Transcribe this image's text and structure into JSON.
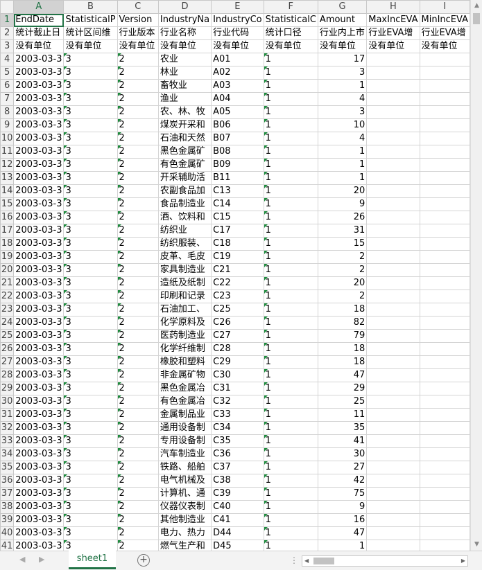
{
  "columns": [
    "A",
    "B",
    "C",
    "D",
    "E",
    "F",
    "G",
    "H",
    "I"
  ],
  "header_rows": [
    [
      "EndDate",
      "StatisticalP",
      "Version",
      "IndustryNa",
      "IndustryCo",
      "StatisticalC",
      "Amount",
      "MaxIncEVA",
      "MinIncEVA"
    ],
    [
      "统计截止日",
      "统计区间维",
      "行业版本",
      "行业名称",
      "行业代码",
      "统计口径",
      "行业内上市",
      "行业EVA增",
      "行业EVA增"
    ],
    [
      "没有单位",
      "没有单位",
      "没有单位",
      "没有单位",
      "没有单位",
      "没有单位",
      "没有单位",
      "没有单位",
      "没有单位"
    ]
  ],
  "data_rows": [
    {
      "date": "2003-03-3",
      "b": "3",
      "c": "2",
      "name": "农业",
      "code": "A01",
      "f": "1",
      "amount": "17"
    },
    {
      "date": "2003-03-3",
      "b": "3",
      "c": "2",
      "name": "林业",
      "code": "A02",
      "f": "1",
      "amount": "3"
    },
    {
      "date": "2003-03-3",
      "b": "3",
      "c": "2",
      "name": "畜牧业",
      "code": "A03",
      "f": "1",
      "amount": "1"
    },
    {
      "date": "2003-03-3",
      "b": "3",
      "c": "2",
      "name": "渔业",
      "code": "A04",
      "f": "1",
      "amount": "4"
    },
    {
      "date": "2003-03-3",
      "b": "3",
      "c": "2",
      "name": "农、林、牧",
      "code": "A05",
      "f": "1",
      "amount": "3"
    },
    {
      "date": "2003-03-3",
      "b": "3",
      "c": "2",
      "name": "煤炭开采和",
      "code": "B06",
      "f": "1",
      "amount": "10"
    },
    {
      "date": "2003-03-3",
      "b": "3",
      "c": "2",
      "name": "石油和天然",
      "code": "B07",
      "f": "1",
      "amount": "4"
    },
    {
      "date": "2003-03-3",
      "b": "3",
      "c": "2",
      "name": "黑色金属矿",
      "code": "B08",
      "f": "1",
      "amount": "1"
    },
    {
      "date": "2003-03-3",
      "b": "3",
      "c": "2",
      "name": "有色金属矿",
      "code": "B09",
      "f": "1",
      "amount": "1"
    },
    {
      "date": "2003-03-3",
      "b": "3",
      "c": "2",
      "name": "开采辅助活",
      "code": "B11",
      "f": "1",
      "amount": "1"
    },
    {
      "date": "2003-03-3",
      "b": "3",
      "c": "2",
      "name": "农副食品加",
      "code": "C13",
      "f": "1",
      "amount": "20"
    },
    {
      "date": "2003-03-3",
      "b": "3",
      "c": "2",
      "name": "食品制造业",
      "code": "C14",
      "f": "1",
      "amount": "9"
    },
    {
      "date": "2003-03-3",
      "b": "3",
      "c": "2",
      "name": "酒、饮料和",
      "code": "C15",
      "f": "1",
      "amount": "26"
    },
    {
      "date": "2003-03-3",
      "b": "3",
      "c": "2",
      "name": "纺织业",
      "code": "C17",
      "f": "1",
      "amount": "31"
    },
    {
      "date": "2003-03-3",
      "b": "3",
      "c": "2",
      "name": "纺织服装、",
      "code": "C18",
      "f": "1",
      "amount": "15"
    },
    {
      "date": "2003-03-3",
      "b": "3",
      "c": "2",
      "name": "皮革、毛皮",
      "code": "C19",
      "f": "1",
      "amount": "2"
    },
    {
      "date": "2003-03-3",
      "b": "3",
      "c": "2",
      "name": "家具制造业",
      "code": "C21",
      "f": "1",
      "amount": "2"
    },
    {
      "date": "2003-03-3",
      "b": "3",
      "c": "2",
      "name": "造纸及纸制",
      "code": "C22",
      "f": "1",
      "amount": "20"
    },
    {
      "date": "2003-03-3",
      "b": "3",
      "c": "2",
      "name": "印刷和记录",
      "code": "C23",
      "f": "1",
      "amount": "2"
    },
    {
      "date": "2003-03-3",
      "b": "3",
      "c": "2",
      "name": "石油加工、",
      "code": "C25",
      "f": "1",
      "amount": "18"
    },
    {
      "date": "2003-03-3",
      "b": "3",
      "c": "2",
      "name": "化学原料及",
      "code": "C26",
      "f": "1",
      "amount": "82"
    },
    {
      "date": "2003-03-3",
      "b": "3",
      "c": "2",
      "name": "医药制造业",
      "code": "C27",
      "f": "1",
      "amount": "79"
    },
    {
      "date": "2003-03-3",
      "b": "3",
      "c": "2",
      "name": "化学纤维制",
      "code": "C28",
      "f": "1",
      "amount": "18"
    },
    {
      "date": "2003-03-3",
      "b": "3",
      "c": "2",
      "name": "橡胶和塑料",
      "code": "C29",
      "f": "1",
      "amount": "18"
    },
    {
      "date": "2003-03-3",
      "b": "3",
      "c": "2",
      "name": "非金属矿物",
      "code": "C30",
      "f": "1",
      "amount": "47"
    },
    {
      "date": "2003-03-3",
      "b": "3",
      "c": "2",
      "name": "黑色金属冶",
      "code": "C31",
      "f": "1",
      "amount": "29"
    },
    {
      "date": "2003-03-3",
      "b": "3",
      "c": "2",
      "name": "有色金属冶",
      "code": "C32",
      "f": "1",
      "amount": "25"
    },
    {
      "date": "2003-03-3",
      "b": "3",
      "c": "2",
      "name": "金属制品业",
      "code": "C33",
      "f": "1",
      "amount": "11"
    },
    {
      "date": "2003-03-3",
      "b": "3",
      "c": "2",
      "name": "通用设备制",
      "code": "C34",
      "f": "1",
      "amount": "35"
    },
    {
      "date": "2003-03-3",
      "b": "3",
      "c": "2",
      "name": "专用设备制",
      "code": "C35",
      "f": "1",
      "amount": "41"
    },
    {
      "date": "2003-03-3",
      "b": "3",
      "c": "2",
      "name": "汽车制造业",
      "code": "C36",
      "f": "1",
      "amount": "30"
    },
    {
      "date": "2003-03-3",
      "b": "3",
      "c": "2",
      "name": "铁路、船舶",
      "code": "C37",
      "f": "1",
      "amount": "27"
    },
    {
      "date": "2003-03-3",
      "b": "3",
      "c": "2",
      "name": "电气机械及",
      "code": "C38",
      "f": "1",
      "amount": "42"
    },
    {
      "date": "2003-03-3",
      "b": "3",
      "c": "2",
      "name": "计算机、通",
      "code": "C39",
      "f": "1",
      "amount": "75"
    },
    {
      "date": "2003-03-3",
      "b": "3",
      "c": "2",
      "name": "仪器仪表制",
      "code": "C40",
      "f": "1",
      "amount": "9"
    },
    {
      "date": "2003-03-3",
      "b": "3",
      "c": "2",
      "name": "其他制造业",
      "code": "C41",
      "f": "1",
      "amount": "16"
    },
    {
      "date": "2003-03-3",
      "b": "3",
      "c": "2",
      "name": "电力、热力",
      "code": "D44",
      "f": "1",
      "amount": "47"
    },
    {
      "date": "2003-03-3",
      "b": "3",
      "c": "2",
      "name": "燃气生产和",
      "code": "D45",
      "f": "1",
      "amount": "1"
    }
  ],
  "active_column": "A",
  "active_row": "1",
  "sheet_tab": "sheet1",
  "add_sheet_icon": "plus-circle-icon",
  "accent_color": "#217346"
}
